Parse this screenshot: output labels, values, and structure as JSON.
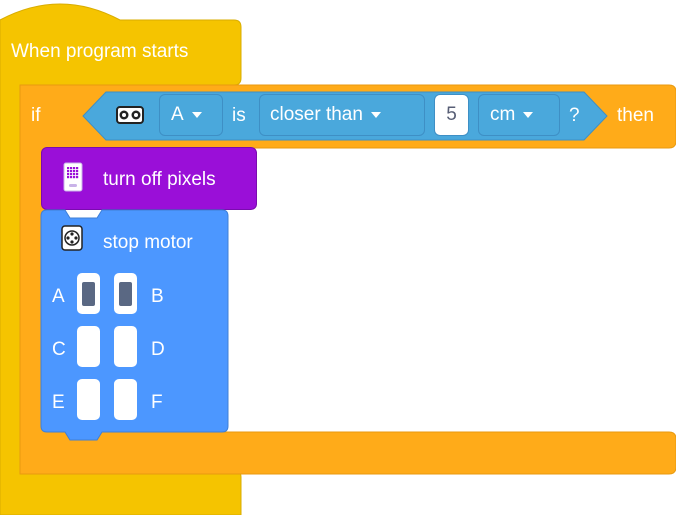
{
  "event_block": {
    "label": "When program starts",
    "color": "#f5c400"
  },
  "if_block": {
    "if_label": "if",
    "then_label": "then",
    "color": "#ffab19",
    "condition": {
      "sensor_icon": "distance-sensor-icon",
      "port": "A",
      "is_label": "is",
      "comparison": "closer than",
      "value": "5",
      "unit": "cm",
      "question_mark": "?",
      "color": "#4aa8dc"
    }
  },
  "pixels_block": {
    "label": "turn off pixels",
    "icon": "light-matrix-icon",
    "color": "#9a0fd8"
  },
  "motor_block": {
    "label": "stop motor",
    "icon": "motor-icon",
    "color": "#4c97ff",
    "ports": [
      {
        "letter": "A",
        "selected": true
      },
      {
        "letter": "B",
        "selected": true
      },
      {
        "letter": "C",
        "selected": false
      },
      {
        "letter": "D",
        "selected": false
      },
      {
        "letter": "E",
        "selected": false
      },
      {
        "letter": "F",
        "selected": false
      }
    ]
  }
}
